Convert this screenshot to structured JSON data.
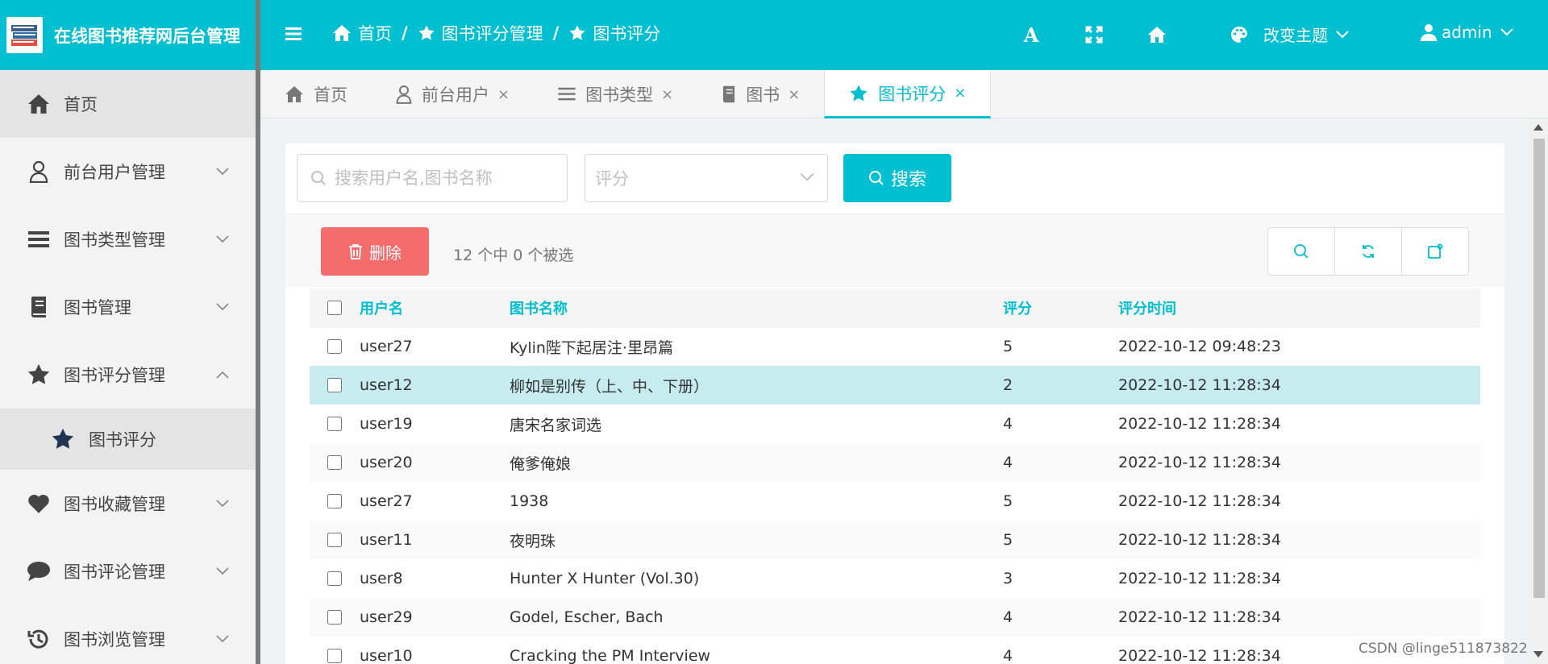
{
  "brand": {
    "title": "在线图书推荐网后台管理"
  },
  "breadcrumb": [
    {
      "label": "首页",
      "icon": "home-icon"
    },
    {
      "label": "图书评分管理",
      "icon": "star-icon"
    },
    {
      "label": "图书评分",
      "icon": "star-icon"
    }
  ],
  "breadcrumb_sep": "/",
  "header": {
    "font_icon": "A",
    "theme_label": "改变主题",
    "user_label": "admin"
  },
  "sidebar": {
    "items": [
      {
        "label": "首页",
        "icon": "home-icon",
        "active": true
      },
      {
        "label": "前台用户管理",
        "icon": "user-icon"
      },
      {
        "label": "图书类型管理",
        "icon": "list-icon"
      },
      {
        "label": "图书管理",
        "icon": "book-icon"
      },
      {
        "label": "图书评分管理",
        "icon": "star-icon",
        "expanded": true
      },
      {
        "label": "图书收藏管理",
        "icon": "heart-icon"
      },
      {
        "label": "图书评论管理",
        "icon": "comment-icon"
      },
      {
        "label": "图书浏览管理",
        "icon": "history-icon"
      }
    ],
    "sub_item": {
      "label": "图书评分",
      "icon": "star-icon"
    }
  },
  "tabs": [
    {
      "label": "首页",
      "icon": "home-icon",
      "closable": false
    },
    {
      "label": "前台用户",
      "icon": "user-icon",
      "closable": true
    },
    {
      "label": "图书类型",
      "icon": "list-icon",
      "closable": true
    },
    {
      "label": "图书",
      "icon": "book-icon",
      "closable": true
    },
    {
      "label": "图书评分",
      "icon": "star-icon",
      "closable": true,
      "active": true
    }
  ],
  "tab_close": "×",
  "search": {
    "placeholder": "搜索用户名,图书名称",
    "rating_placeholder": "评分",
    "button_label": "搜索"
  },
  "toolbar": {
    "delete_label": "删除",
    "selection_text": "12 个中 0 个被选"
  },
  "table": {
    "columns": [
      "用户名",
      "图书名称",
      "评分",
      "评分时间"
    ],
    "rows": [
      [
        "user27",
        "Kylin陛下起居注·里昂篇",
        "5",
        "2022-10-12 09:48:23"
      ],
      [
        "user12",
        "柳如是别传（上、中、下册）",
        "2",
        "2022-10-12 11:28:34"
      ],
      [
        "user19",
        "唐宋名家词选",
        "4",
        "2022-10-12 11:28:34"
      ],
      [
        "user20",
        "俺爹俺娘",
        "4",
        "2022-10-12 11:28:34"
      ],
      [
        "user27",
        "1938",
        "5",
        "2022-10-12 11:28:34"
      ],
      [
        "user11",
        "夜明珠",
        "5",
        "2022-10-12 11:28:34"
      ],
      [
        "user8",
        "Hunter X Hunter (Vol.30)",
        "3",
        "2022-10-12 11:28:34"
      ],
      [
        "user29",
        "Godel, Escher, Bach",
        "4",
        "2022-10-12 11:28:34"
      ],
      [
        "user10",
        "Cracking the PM Interview",
        "4",
        "2022-10-12 11:28:34"
      ]
    ],
    "highlighted_row": 1
  },
  "watermark": "CSDN @linge511873822",
  "colors": {
    "primary": "#00bfd0",
    "danger": "#f56c6c",
    "highlight": "#c6ecf0"
  }
}
